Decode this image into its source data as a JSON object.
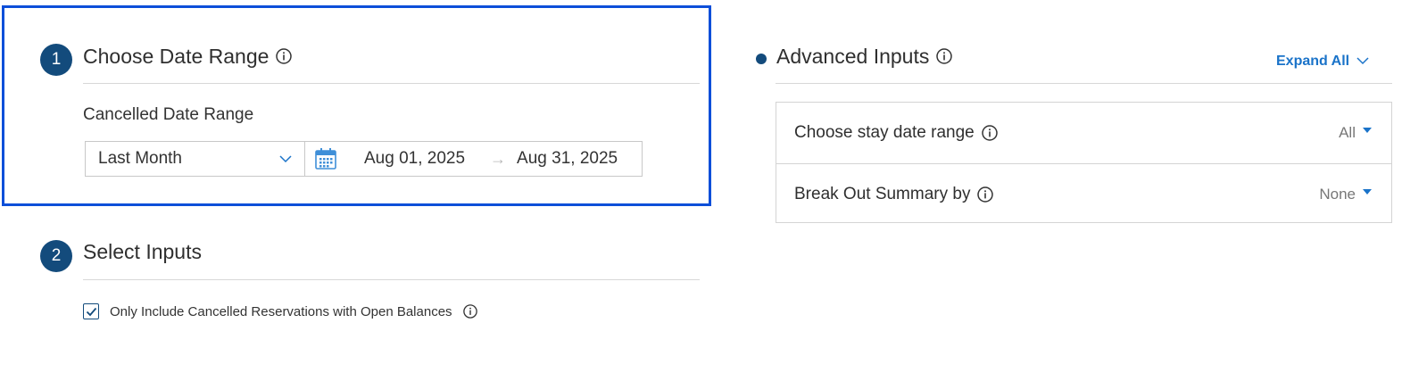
{
  "step1": {
    "number": "1",
    "title": "Choose Date Range",
    "field_label": "Cancelled Date Range",
    "preset_value": "Last Month",
    "start_date": "Aug 01, 2025",
    "end_date": "Aug 31, 2025",
    "arrow": "→"
  },
  "step2": {
    "number": "2",
    "title": "Select Inputs",
    "checkbox_label": "Only Include Cancelled Reservations with Open Balances",
    "checkbox_checked": true
  },
  "advanced": {
    "title": "Advanced Inputs",
    "expand_label": "Expand All",
    "rows": [
      {
        "label": "Choose stay date range",
        "value": "All"
      },
      {
        "label": "Break Out Summary by",
        "value": "None"
      }
    ]
  },
  "colors": {
    "highlight": "#0d4fd9",
    "badge": "#134b7c",
    "link": "#1a73c9"
  }
}
